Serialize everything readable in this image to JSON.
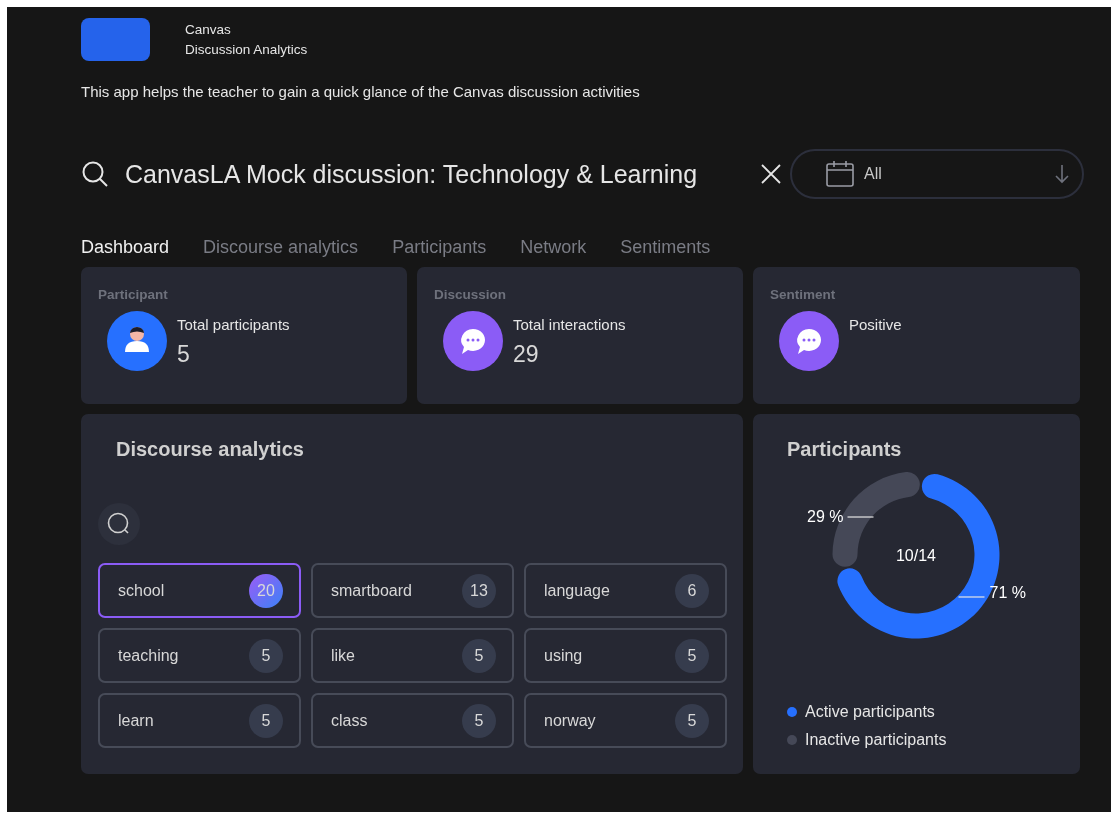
{
  "app": {
    "title": "Canvas",
    "subtitle": "Discussion Analytics",
    "description": "This app helps the teacher to gain a quick glance of the Canvas discussion activities"
  },
  "search": {
    "value": "CanvasLA Mock discussion: Technology & Learning"
  },
  "date_filter": {
    "value": "All"
  },
  "tabs": [
    {
      "label": "Dashboard",
      "selected": true
    },
    {
      "label": "Discourse analytics",
      "selected": false
    },
    {
      "label": "Participants",
      "selected": false
    },
    {
      "label": "Network",
      "selected": false
    },
    {
      "label": "Sentiments",
      "selected": false
    }
  ],
  "summary_cards": [
    {
      "heading": "Participant",
      "label": "Total participants",
      "value": "5",
      "kind": "person"
    },
    {
      "heading": "Discussion",
      "label": "Total interactions",
      "value": "29",
      "kind": "chat"
    },
    {
      "heading": "Sentiment",
      "label": "Positive",
      "kind": "chat"
    }
  ],
  "discourse": {
    "title": "Discourse analytics",
    "keywords": [
      {
        "word": "school",
        "count": "20",
        "selected": true
      },
      {
        "word": "smartboard",
        "count": "13",
        "selected": false
      },
      {
        "word": "language",
        "count": "6",
        "selected": false
      },
      {
        "word": "teaching",
        "count": "5",
        "selected": false
      },
      {
        "word": "like",
        "count": "5",
        "selected": false
      },
      {
        "word": "using",
        "count": "5",
        "selected": false
      },
      {
        "word": "learn",
        "count": "5",
        "selected": false
      },
      {
        "word": "class",
        "count": "5",
        "selected": false
      },
      {
        "word": "norway",
        "count": "5",
        "selected": false
      }
    ]
  },
  "participants": {
    "title": "Participants",
    "center_label": "10/14",
    "chart_data": {
      "type": "donut",
      "categories": [
        "Active participants",
        "Inactive participants"
      ],
      "values": [
        71,
        29
      ],
      "colors": [
        "#2670ff",
        "#454857"
      ],
      "value_labels": [
        "71 %",
        "29 %"
      ]
    }
  }
}
